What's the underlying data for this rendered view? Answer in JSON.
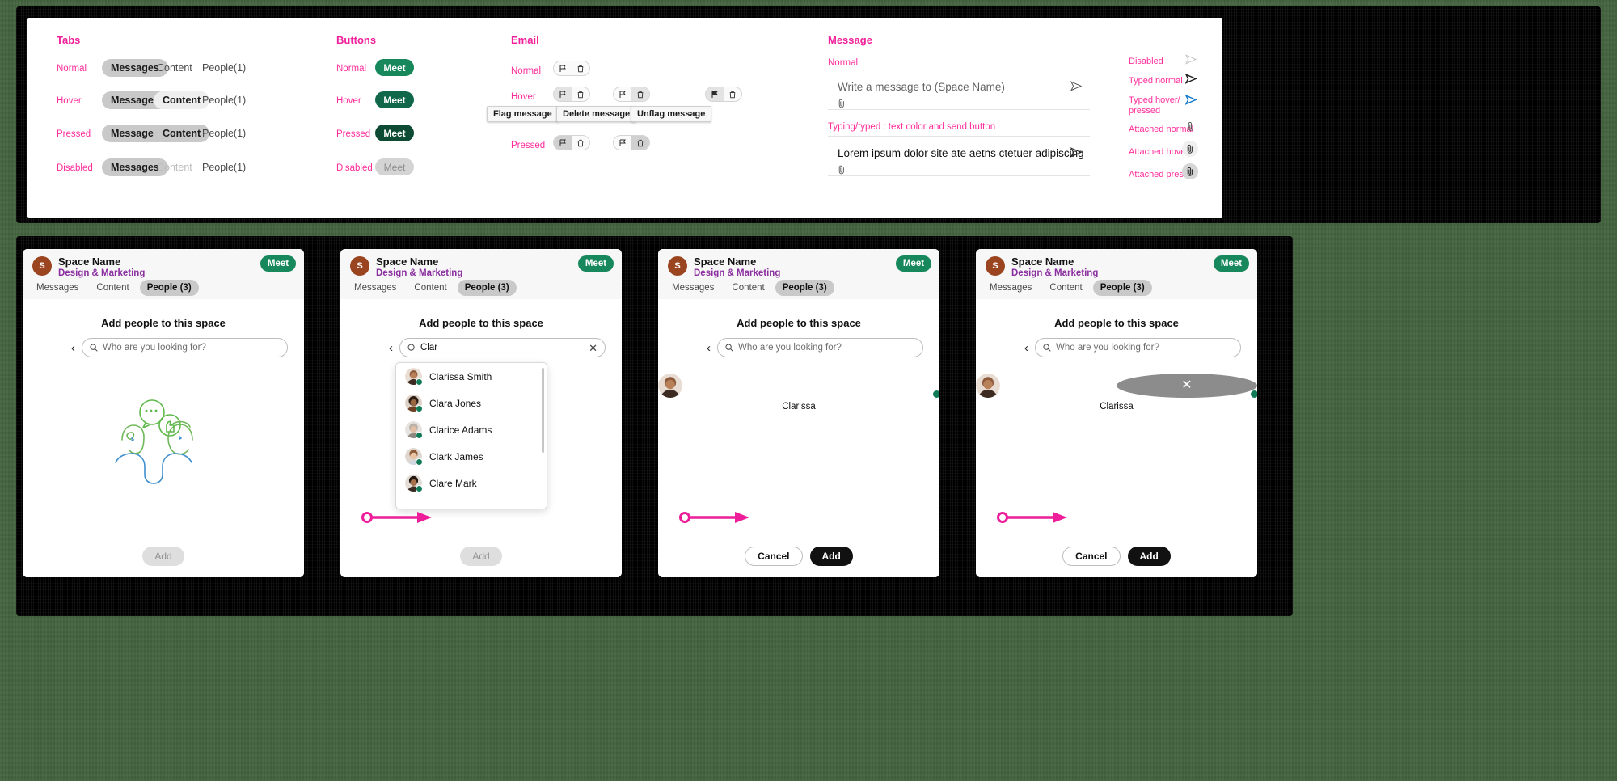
{
  "spec": {
    "sections": {
      "tabs": {
        "title": "Tabs",
        "states": [
          "Normal",
          "Hover",
          "Pressed",
          "Disabled"
        ],
        "items": [
          "Messages",
          "Content",
          "People(1)"
        ]
      },
      "buttons": {
        "title": "Buttons",
        "states": [
          "Normal",
          "Hover",
          "Pressed",
          "Disabled"
        ],
        "label": "Meet"
      },
      "email": {
        "title": "Email",
        "states": [
          "Normal",
          "Hover",
          "Pressed"
        ],
        "tooltips": [
          "Flag message",
          "Delete message",
          "Unflag message"
        ],
        "icons": [
          "flag-icon",
          "trash-icon"
        ]
      },
      "message": {
        "title": "Message",
        "normal_label": "Normal",
        "placeholder": "Write a message to (Space Name)",
        "typing_label": "Typing/typed : text color and send button",
        "typed_value": "Lorem ipsum dolor site ate aetns ctetuer adipiscing",
        "states": [
          {
            "label": "Disabled",
            "icon": "send-icon"
          },
          {
            "label": "Typed normal",
            "icon": "send-icon"
          },
          {
            "label": "Typed hover/ pressed",
            "icon": "send-icon"
          },
          {
            "label": "Attached normal",
            "icon": "paperclip-icon"
          },
          {
            "label": "Attached hover",
            "icon": "paperclip-icon"
          },
          {
            "label": "Attached pressed",
            "icon": "paperclip-icon"
          }
        ]
      }
    }
  },
  "phone": {
    "header": {
      "avatar_initial": "S",
      "space_name": "Space Name",
      "space_subtitle": "Design & Marketing",
      "meet_label": "Meet"
    },
    "tabs": [
      {
        "label": "Messages",
        "active": false
      },
      {
        "label": "Content",
        "active": false
      },
      {
        "label": "People (3)",
        "active": true
      }
    ],
    "body_title": "Add people to this space",
    "search_placeholder": "Who are you looking for?",
    "search_value": "Clar",
    "results": [
      "Clarissa Smith",
      "Clara Jones",
      "Clarice Adams",
      "Clark James",
      "Clare Mark"
    ],
    "selected_person": "Clarissa",
    "buttons": {
      "add": "Add",
      "cancel": "Cancel"
    }
  },
  "colors": {
    "accent_pink": "#ff2d9b",
    "green": "#17875c",
    "purple": "#8b2fa0",
    "avatar_brown": "#9a4520",
    "black": "#111111"
  }
}
